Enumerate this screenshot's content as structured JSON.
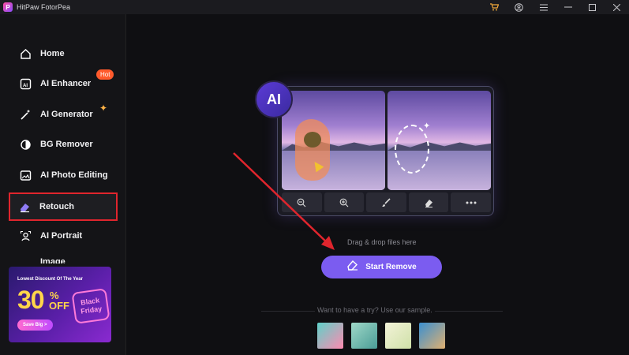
{
  "window": {
    "title": "HitPaw FotorPea",
    "logo_letter": "P",
    "controls": [
      "cart-icon",
      "account-icon",
      "menu-icon",
      "minimize-icon",
      "maximize-icon",
      "close-icon"
    ]
  },
  "sidebar": {
    "items": [
      {
        "label": "Home",
        "icon": "home-icon"
      },
      {
        "label": "AI Enhancer",
        "icon": "ai-enhancer-icon",
        "badge": "Hot"
      },
      {
        "label": "AI Generator",
        "icon": "magic-wand-icon"
      },
      {
        "label": "BG Remover",
        "icon": "bg-remover-icon"
      },
      {
        "label": "AI Photo Editing",
        "icon": "photo-edit-icon"
      },
      {
        "label": "Retouch",
        "icon": "eraser-icon",
        "active": true
      },
      {
        "label": "AI Portrait",
        "icon": "portrait-icon"
      },
      {
        "label": "Image",
        "icon": "image-icon"
      }
    ],
    "promo": {
      "title": "Lowest Discount Of The Year",
      "big_number": "30",
      "percent": "%",
      "off": "OFF",
      "tag_line1": "Black",
      "tag_line2": "Friday",
      "button": "Save Big >"
    }
  },
  "main": {
    "ai_badge": "AI",
    "tools": [
      "zoom-out-icon",
      "zoom-in-icon",
      "brush-icon",
      "eraser-icon",
      "more-icon"
    ],
    "drag_text": "Drag & drop files here",
    "start_button": "Start Remove",
    "sample_text": "Want to have a try? Use our sample.",
    "samples": [
      "sample-flamingo",
      "sample-hand",
      "sample-paper",
      "sample-people"
    ]
  },
  "colors": {
    "accent": "#7b5cf0",
    "highlight_box": "#e0252d",
    "hot_badge": "#ff5a2c",
    "arrow": "#e0252d"
  }
}
